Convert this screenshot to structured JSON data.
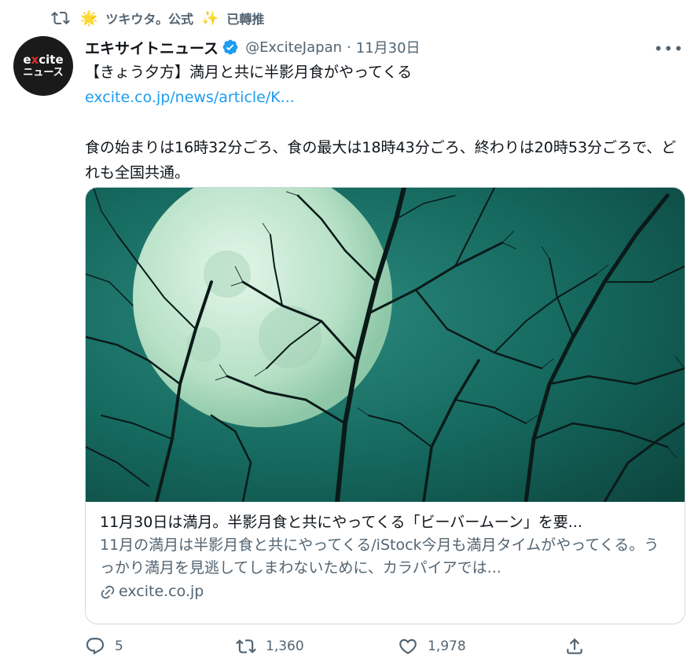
{
  "retweet": {
    "user": "ツキウタ。公式",
    "suffix": "已轉推"
  },
  "avatar": {
    "brand_pre": "e",
    "brand_x": "x",
    "brand_post": "cite",
    "sub": "ニュース"
  },
  "tweet": {
    "display_name": "エキサイトニュース",
    "handle": "@ExciteJapan",
    "separator": "·",
    "date": "11月30日",
    "more": "•••",
    "headline": "【きょう夕方】満月と共に半影月食がやってくる",
    "link": "excite.co.jp/news/article/K...",
    "body": "食の始まりは16時32分ごろ、食の最大は18時43分ごろ、終わりは20時53分ごろで、どれも全国共通。"
  },
  "card": {
    "title": "11月30日は満月。半影月食と共にやってくる「ビーバームーン」を要...",
    "description": "11月の満月は半影月食と共にやってくる/iStock今月も満月タイムがやってくる。うっかり満月を見逃してしまわないために、カラパイアでは...",
    "domain": "excite.co.jp"
  },
  "actions": {
    "reply_count": "5",
    "retweet_count": "1,360",
    "like_count": "1,978"
  },
  "colors": {
    "accent": "#1d9bf0",
    "muted": "#536471",
    "image_sky": "#0f4d47",
    "moon": "#b9e3c9"
  }
}
